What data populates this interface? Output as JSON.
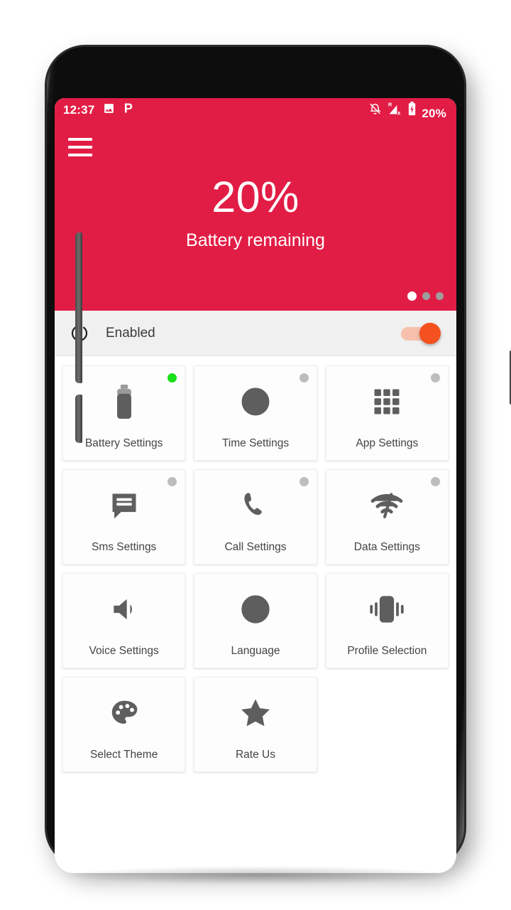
{
  "status_bar": {
    "clock": "12:37",
    "left_icons": [
      "image-icon",
      "p-app-icon"
    ],
    "right_icons": [
      "bell-off-icon",
      "signal-roaming-off-icon",
      "battery-charging-icon"
    ],
    "battery_text": "20%"
  },
  "hero": {
    "menu_icon": "hamburger-menu-icon",
    "percent": "20%",
    "caption": "Battery remaining",
    "accent_color": "#E21D45",
    "page_dots": {
      "count": 3,
      "active_index": 0
    }
  },
  "enabled_row": {
    "icon": "power-icon",
    "label": "Enabled",
    "toggle_on": true,
    "toggle_color": "#F4511E",
    "toggle_track_color": "#F6C1AC"
  },
  "tiles": [
    {
      "label": "Battery Settings",
      "icon": "battery-icon",
      "status": "on",
      "status_color": "#19E019"
    },
    {
      "label": "Time Settings",
      "icon": "clock-icon",
      "status": "off",
      "status_color": "#BDBDBD"
    },
    {
      "label": "App Settings",
      "icon": "apps-grid-icon",
      "status": "off",
      "status_color": "#BDBDBD"
    },
    {
      "label": "Sms Settings",
      "icon": "message-bubble-icon",
      "status": "off",
      "status_color": "#BDBDBD"
    },
    {
      "label": "Call Settings",
      "icon": "phone-icon",
      "status": "off",
      "status_color": "#BDBDBD"
    },
    {
      "label": "Data Settings",
      "icon": "wifi-off-icon",
      "status": "off",
      "status_color": "#BDBDBD"
    },
    {
      "label": "Voice Settings",
      "icon": "speaker-icon",
      "status": "none"
    },
    {
      "label": "Language",
      "icon": "globe-icon",
      "status": "none"
    },
    {
      "label": "Profile Selection",
      "icon": "vibrate-icon",
      "status": "none"
    },
    {
      "label": "Select Theme",
      "icon": "palette-icon",
      "status": "none"
    },
    {
      "label": "Rate Us",
      "icon": "star-icon",
      "status": "none"
    }
  ]
}
